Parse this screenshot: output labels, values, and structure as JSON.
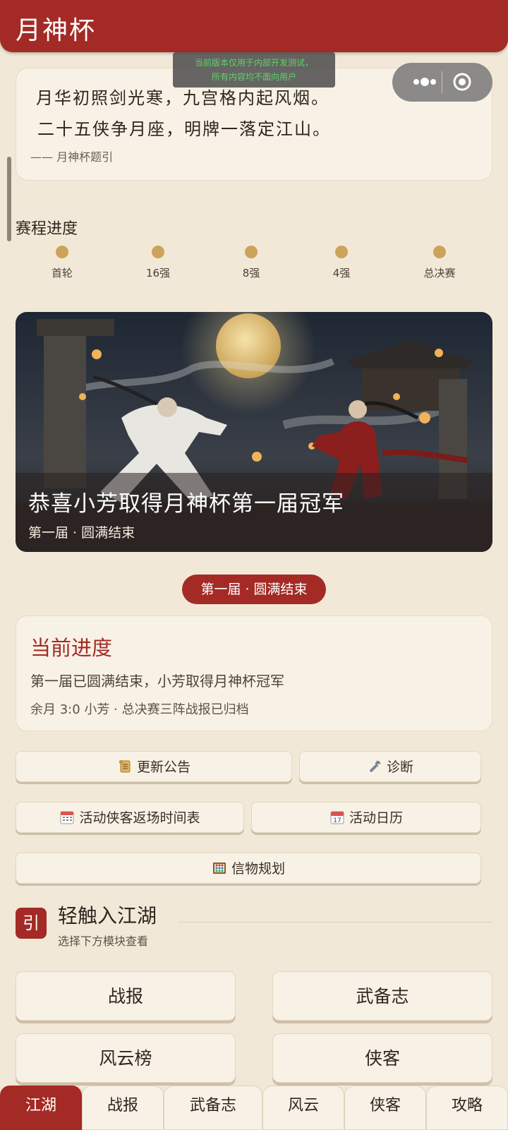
{
  "header": {
    "title": "月神杯"
  },
  "dev_banner": {
    "line1": "当前版本仅用于内部开发测试，",
    "line2": "所有内容均不面向用户"
  },
  "capsule": {
    "more_icon": "more-dots-icon",
    "close_icon": "target-circle-icon"
  },
  "poem": {
    "line1": "月华初照剑光寒，九宫格内起风烟。",
    "line2": "二十五侠争月座，明牌一落定江山。",
    "signature": "—— 月神杯题引"
  },
  "schedule": {
    "title": "赛程进度",
    "stages": [
      "首轮",
      "16强",
      "8强",
      "4强",
      "总决赛"
    ]
  },
  "banner": {
    "title": "恭喜小芳取得月神杯第一届冠军",
    "subtitle": "第一届 · 圆满结束"
  },
  "status_pill": "第一届 · 圆满结束",
  "progress": {
    "title": "当前进度",
    "line1": "第一届已圆满结束，小芳取得月神杯冠军",
    "line2": "余月 3:0 小芳 · 总决赛三阵战报已归档"
  },
  "buttons": {
    "announcement": "更新公告",
    "diagnose": "诊断",
    "return_schedule": "活动侠客返场时间表",
    "event_calendar": "活动日历",
    "token_plan": "信物规划"
  },
  "guide": {
    "badge": "引",
    "title": "轻触入江湖",
    "subtitle": "选择下方模块查看"
  },
  "modules": [
    "战报",
    "武备志",
    "风云榜",
    "侠客"
  ],
  "tabs": [
    "江湖",
    "战报",
    "武备志",
    "风云",
    "侠客",
    "攻略"
  ],
  "colors": {
    "brand_red": "#a42a25",
    "background": "#f2e8d8",
    "card": "#f8f2e6",
    "gold": "#cba35a"
  }
}
